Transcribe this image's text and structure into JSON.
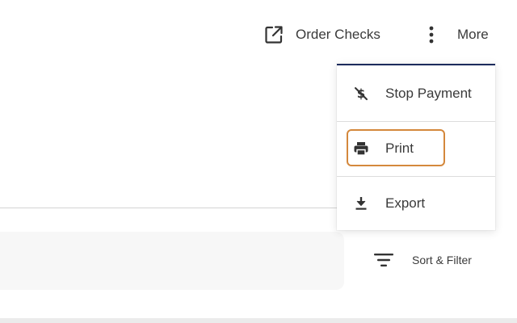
{
  "header": {
    "order_checks": {
      "label": "Order Checks",
      "icon": "external-link-icon"
    },
    "more": {
      "label": "More",
      "icon": "vertical-dots-icon"
    }
  },
  "more_menu": {
    "items": [
      {
        "label": "Stop Payment",
        "icon": "stop-payment-icon"
      },
      {
        "label": "Print",
        "icon": "printer-icon",
        "focused": true
      },
      {
        "label": "Export",
        "icon": "download-icon"
      }
    ]
  },
  "toolbar": {
    "sort_filter_label": "Sort & Filter",
    "sort_filter_icon": "filter-lines-icon"
  },
  "colors": {
    "menu_top_border": "#1c2b5c",
    "focus_ring": "#d4883c",
    "text": "#3a3a3a",
    "search_bar_bg": "#f7f7f7"
  }
}
